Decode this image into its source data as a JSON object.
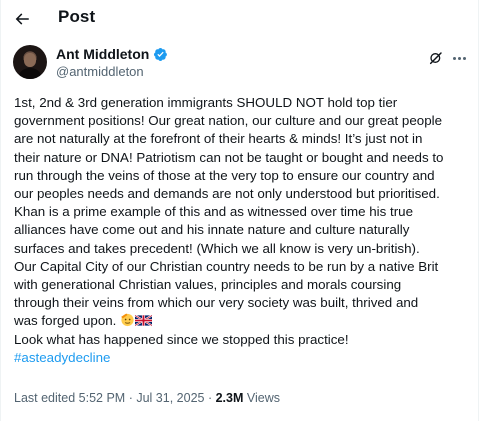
{
  "header": {
    "title": "Post"
  },
  "author": {
    "display_name": "Ant Middleton",
    "handle": "@antmiddleton"
  },
  "post": {
    "lines": [
      "1st, 2nd & 3rd generation immigrants SHOULD NOT hold top tier",
      "government positions! Our great nation, our culture and our great people",
      "are not naturally at the forefront of their hearts & minds! It’s just not in",
      "their nature or DNA! Patriotism can not be taught or bought and needs to",
      "run through the veins of those at the very top to ensure our country and",
      "our peoples needs and demands are not only understood but prioritised.",
      "Khan is a prime example of this and as witnessed over time his true",
      "alliances have come out and his innate nature and culture naturally",
      "surfaces and takes precedent! (Which we all know is very un-british).",
      "Our Capital City of our Christian country needs to be run by a native Brit",
      "with generational Christian values, principles and morals coursing",
      "through their veins from which our very society was built, thrived and",
      "was forged upon.",
      "Look what has happened since we stopped this practice!"
    ],
    "emojis": [
      "saluting-face-emoji",
      "uk-flag-emoji"
    ],
    "hashtag": "#asteadydecline"
  },
  "meta": {
    "edited_prefix": "Last edited",
    "time": "5:52 PM",
    "date": "Jul 31, 2025",
    "separator": "·",
    "views_count": "2.3M",
    "views_label": "Views"
  },
  "colors": {
    "link": "#1d9bf0",
    "secondary": "#536471",
    "text": "#0f1419"
  }
}
